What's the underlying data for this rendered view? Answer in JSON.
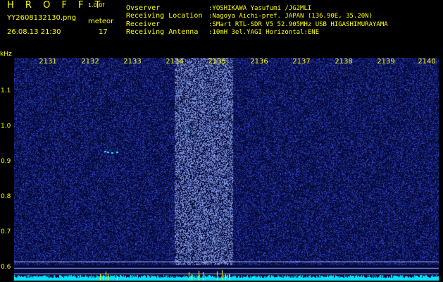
{
  "header": {
    "app_title": "H R O F F T",
    "app_version": "1.0.0f",
    "file_name": "YY2608132130.png",
    "timestamp": "26.08.13 21:30",
    "meteor_label": "meteor",
    "meteor_count": "17"
  },
  "metadata": [
    {
      "key": "Ovserver",
      "value": ":YOSHIKAWA Yasufumi /JG2MLI"
    },
    {
      "key": "Receiving Location",
      "value": ":Nagoya Aichi-pref. JAPAN (136.90E, 35.20N)"
    },
    {
      "key": "Receiver",
      "value": ":SMart RTL-SDR V5 52.905MHz USB HIGASHIMURAYAMA"
    },
    {
      "key": "Receiving Antenna",
      "value": ":10mH 3el.YAGI Horizontal:ENE"
    }
  ],
  "spectrogram": {
    "y_unit": "kHz",
    "y_ticks": [
      "1.1",
      "1.0",
      "0.9",
      "0.8",
      "0.7",
      "0.6"
    ],
    "x_ticks": [
      "2131",
      "2132",
      "2133",
      "2134",
      "2135",
      "2136",
      "2137",
      "2138",
      "2139",
      "2140"
    ],
    "colors": {
      "background": "#050a3c",
      "noise": "#3a5cff",
      "band": "#7f9dff",
      "baseline": "#00e5ff",
      "trigger": "#ffff00",
      "meteor": "#00ffff"
    }
  }
}
